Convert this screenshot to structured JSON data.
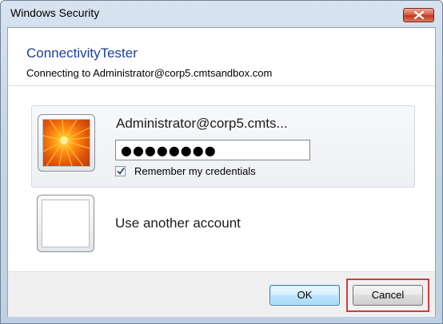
{
  "window": {
    "title": "Windows Security"
  },
  "header": {
    "app_name": "ConnectivityTester",
    "connecting_text": "Connecting to Administrator@corp5.cmtsandbox.com"
  },
  "credentials": {
    "username": "Administrator@corp5.cmts...",
    "password_mask": "●●●●●●●●",
    "remember_label": "Remember my credentials",
    "remember_checked": true
  },
  "other_account": {
    "label": "Use another account"
  },
  "buttons": {
    "ok_label": "OK",
    "cancel_label": "Cancel"
  },
  "icons": {
    "close": "close-icon",
    "user_tile": "flower-user-picture",
    "empty_tile": "blank-user-picture",
    "checkmark": "checkmark-icon"
  },
  "colors": {
    "app_title": "#1a3f9c",
    "close_button": "#c2391f",
    "highlight": "#d33b3b"
  }
}
